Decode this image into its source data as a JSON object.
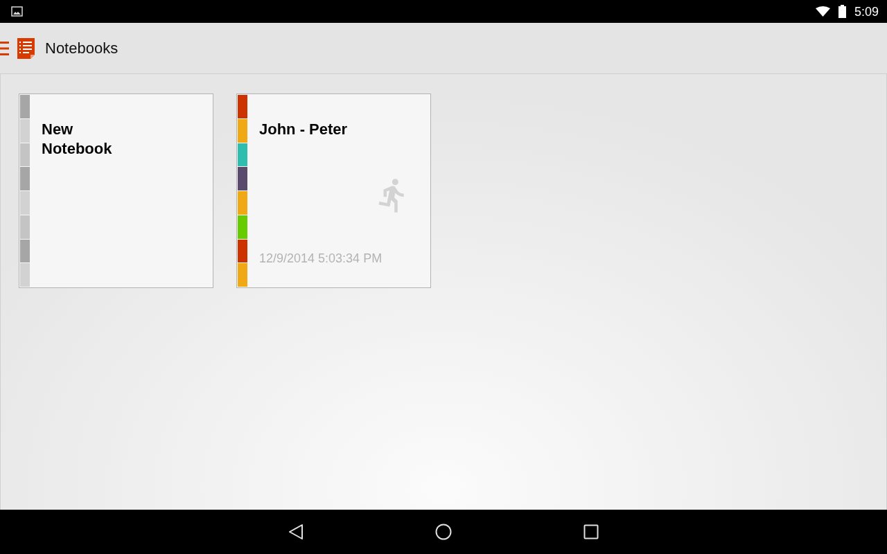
{
  "status_bar": {
    "time": "5:09"
  },
  "app_bar": {
    "title": "Notebooks"
  },
  "notebooks": [
    {
      "kind": "new",
      "title": "New\nNotebook",
      "tabs": [
        {
          "color": "#a6a6a6"
        },
        {
          "color": "#d2d2d2"
        },
        {
          "color": "#c4c4c4"
        },
        {
          "color": "#a6a6a6"
        },
        {
          "color": "#d2d2d2"
        },
        {
          "color": "#c4c4c4"
        },
        {
          "color": "#a6a6a6"
        },
        {
          "color": "#d2d2d2"
        }
      ]
    },
    {
      "kind": "notebook",
      "title": "John - Peter",
      "date": "12/9/2014 5:03:34 PM",
      "tabs": [
        {
          "color": "#cc3300"
        },
        {
          "color": "#f0a814"
        },
        {
          "color": "#2fbdb0"
        },
        {
          "color": "#5a4a6e"
        },
        {
          "color": "#f0a814"
        },
        {
          "color": "#66cc00"
        },
        {
          "color": "#cc3300"
        },
        {
          "color": "#f0a814"
        }
      ]
    }
  ]
}
